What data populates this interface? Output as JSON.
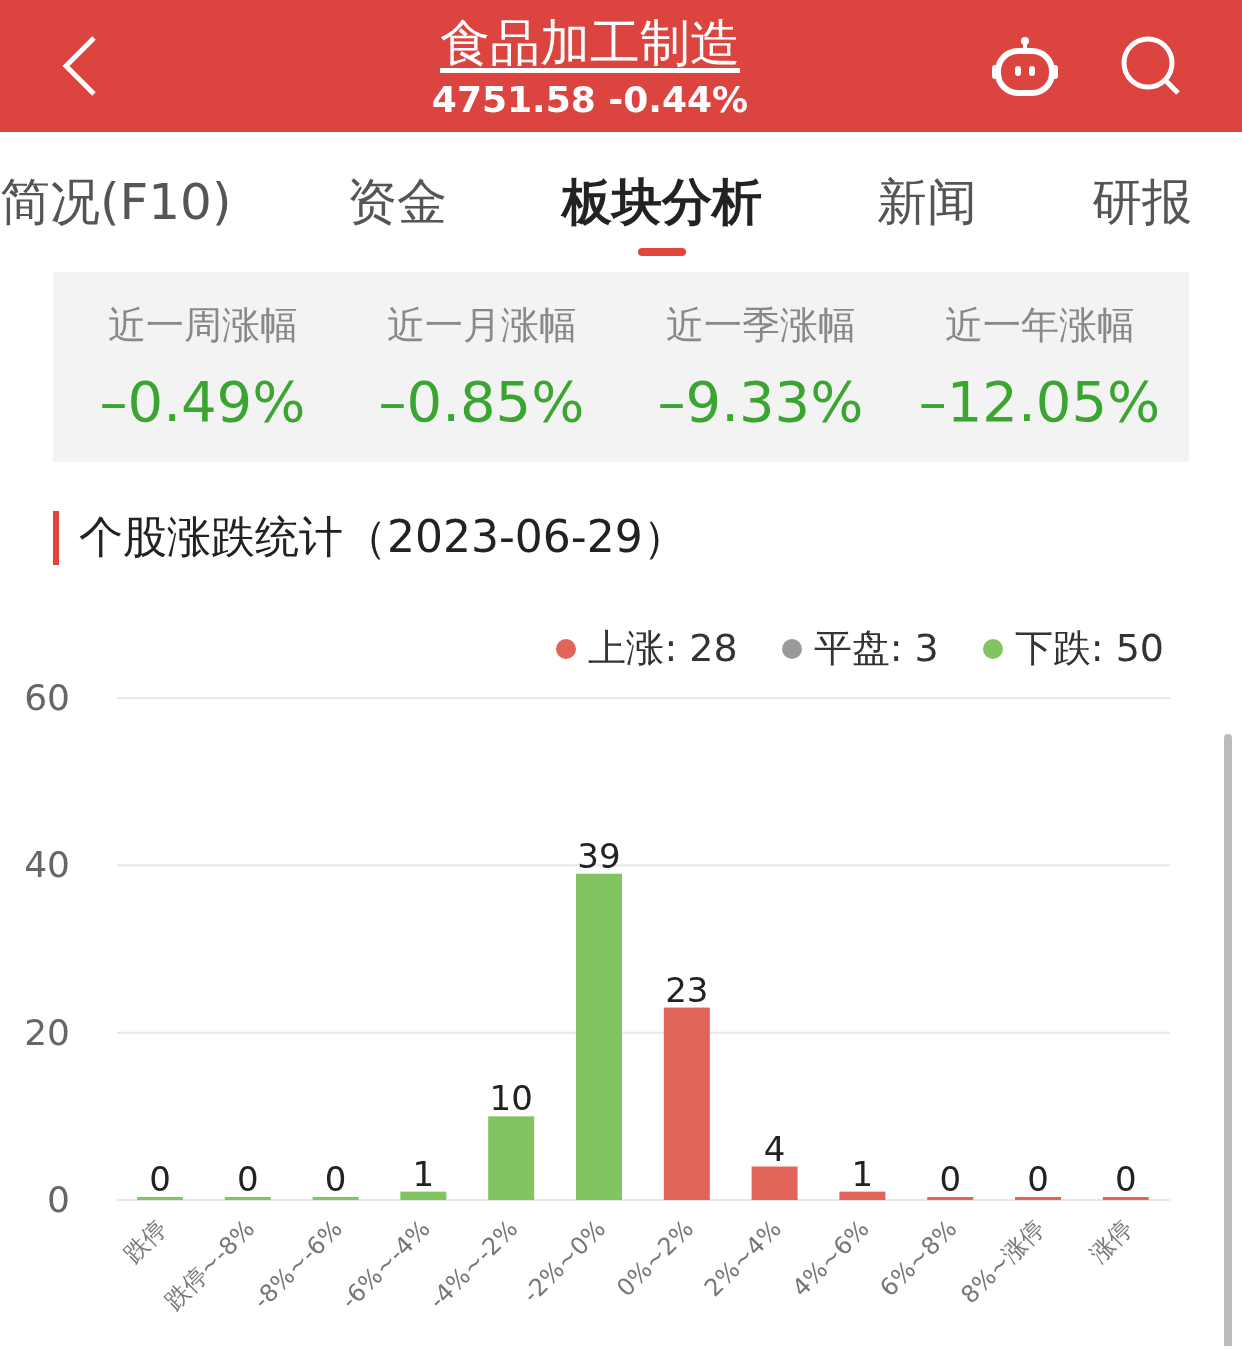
{
  "header": {
    "title": "食品加工制造",
    "quote": "4751.58 -0.44%"
  },
  "tabs": [
    {
      "label": "简况(F10)",
      "selected": false
    },
    {
      "label": "资金",
      "selected": false
    },
    {
      "label": "板块分析",
      "selected": true
    },
    {
      "label": "新闻",
      "selected": false
    },
    {
      "label": "研报",
      "selected": false
    }
  ],
  "stats": [
    {
      "label": "近一周涨幅",
      "value": "–0.49%"
    },
    {
      "label": "近一月涨幅",
      "value": "–0.85%"
    },
    {
      "label": "近一季涨幅",
      "value": "–9.33%"
    },
    {
      "label": "近一年涨幅",
      "value": "–12.05%"
    }
  ],
  "section": {
    "title": "个股涨跌统计（2023-06-29）"
  },
  "legend": [
    {
      "label": "上涨: 28",
      "color": "#e0645a"
    },
    {
      "label": "平盘: 3",
      "color": "#999999"
    },
    {
      "label": "下跌: 50",
      "color": "#82c462"
    }
  ],
  "chart_data": {
    "type": "bar",
    "categories": [
      "跌停",
      "跌停~-8%",
      "-8%~-6%",
      "-6%~-4%",
      "-4%~-2%",
      "-2%~0%",
      "0%~2%",
      "2%~4%",
      "4%~6%",
      "6%~8%",
      "8%~涨停",
      "涨停"
    ],
    "series": [
      {
        "color": "#82c462",
        "values": [
          0,
          0,
          0,
          1,
          10,
          39,
          null,
          null,
          null,
          null,
          null,
          null
        ]
      },
      {
        "color": "#e0645a",
        "values": [
          null,
          null,
          null,
          null,
          null,
          null,
          23,
          4,
          1,
          0,
          0,
          0
        ]
      }
    ],
    "ylim": [
      0,
      60
    ],
    "yticks": [
      0,
      20,
      40,
      60
    ],
    "data_labels": true
  }
}
